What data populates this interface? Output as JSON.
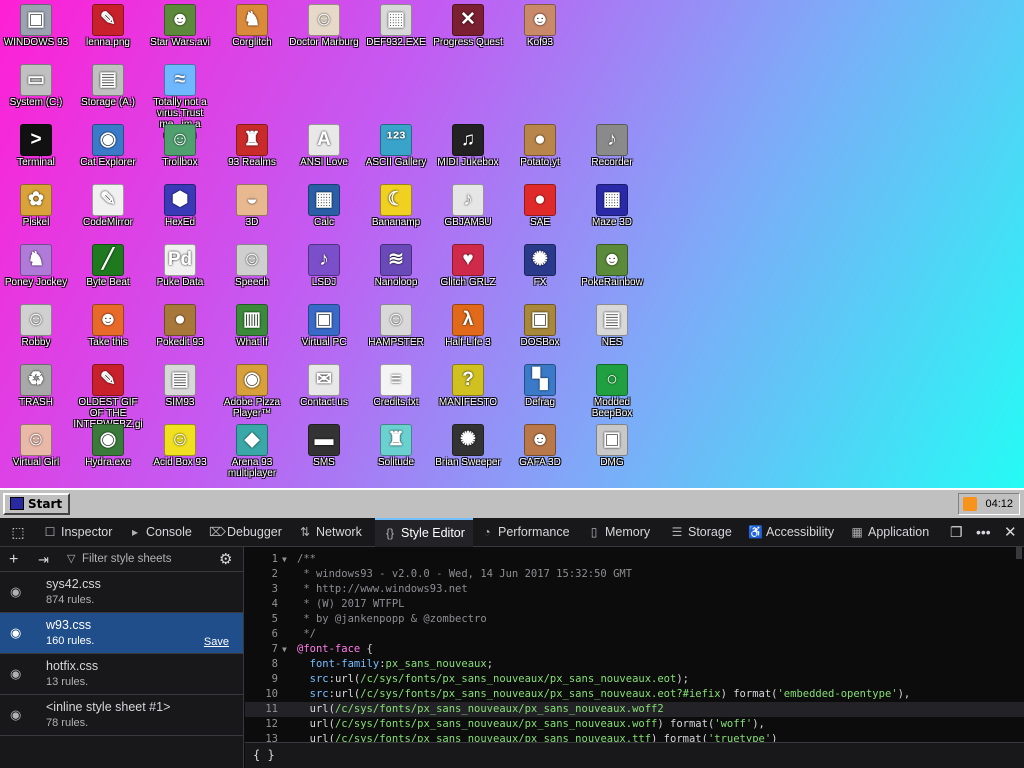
{
  "desktop": {
    "icons": [
      {
        "label": "WINDOWS 93",
        "glyph": "▣",
        "color": "#9ca3b0"
      },
      {
        "label": "lenna.png",
        "glyph": "✎",
        "color": "#c9212b"
      },
      {
        "label": "Star Wars.avi",
        "glyph": "☻",
        "color": "#5d8a3a"
      },
      {
        "label": "Corglitch",
        "glyph": "♞",
        "color": "#d98a3a"
      },
      {
        "label": "Doctor Marburg",
        "glyph": "☺",
        "color": "#e6d9c9"
      },
      {
        "label": "DEF932.EXE",
        "glyph": "▦",
        "color": "#d8d8d8"
      },
      {
        "label": "Progress Quest",
        "glyph": "✕",
        "color": "#7a2030"
      },
      {
        "label": "Kof93",
        "glyph": "☻",
        "color": "#c98a6a"
      },
      {
        "label": "System (C:)",
        "glyph": "▭",
        "color": "#c0c0c0"
      },
      {
        "label": "Storage (A:)",
        "glyph": "▤",
        "color": "#c0c0c0"
      },
      {
        "label": "Totally not a virus.Trust me...im a dolphin",
        "glyph": "≈",
        "color": "#6fb7ff"
      },
      {
        "label": "Terminal",
        "glyph": ">",
        "color": "#111111"
      },
      {
        "label": "Cat Explorer",
        "glyph": "◉",
        "color": "#3a7ac9"
      },
      {
        "label": "Trollbox",
        "glyph": "☺",
        "color": "#4f9f6f"
      },
      {
        "label": "93 Realms",
        "glyph": "♜",
        "color": "#c92b2b"
      },
      {
        "label": "ANSI Love",
        "glyph": "A",
        "color": "#e8e8e8"
      },
      {
        "label": "ASCII Gallery",
        "glyph": "¹²³",
        "color": "#3aa3c9"
      },
      {
        "label": "MIDI Jukebox",
        "glyph": "♫",
        "color": "#222222"
      },
      {
        "label": "Potato.yt",
        "glyph": "●",
        "color": "#b8864a"
      },
      {
        "label": "Recorder",
        "glyph": "♪",
        "color": "#8a8a8a"
      },
      {
        "label": "Piskel",
        "glyph": "✿",
        "color": "#d9a23a"
      },
      {
        "label": "CodeMirror",
        "glyph": "✎",
        "color": "#f0f0f0"
      },
      {
        "label": "HexEd",
        "glyph": "⬢",
        "color": "#3a3ab8"
      },
      {
        "label": "3D",
        "glyph": "◒",
        "color": "#e8b890"
      },
      {
        "label": "Calc",
        "glyph": "▦",
        "color": "#2a5fa8"
      },
      {
        "label": "Bananamp",
        "glyph": "☾",
        "color": "#f0d020"
      },
      {
        "label": "GBJAM3U",
        "glyph": "♪",
        "color": "#e6e6e6"
      },
      {
        "label": "SAE",
        "glyph": "●",
        "color": "#e02a2a"
      },
      {
        "label": "Maze 3D",
        "glyph": "▦",
        "color": "#2a2aa8"
      },
      {
        "label": "Poney Jockey",
        "glyph": "♞",
        "color": "#b07ad9"
      },
      {
        "label": "Byte Beat",
        "glyph": "╱",
        "color": "#1f7a1f"
      },
      {
        "label": "Puke Data",
        "glyph": "Pd",
        "color": "#f0f0f0"
      },
      {
        "label": "Speech",
        "glyph": "☺",
        "color": "#cfcfcf"
      },
      {
        "label": "LSDJ",
        "glyph": "♪",
        "color": "#7a4fc9"
      },
      {
        "label": "Nanoloop",
        "glyph": "≋",
        "color": "#6a4ab8"
      },
      {
        "label": "Glitch GRLZ",
        "glyph": "♥",
        "color": "#d02a4a"
      },
      {
        "label": "FX",
        "glyph": "✺",
        "color": "#2a3a8a"
      },
      {
        "label": "PokeRainbow",
        "glyph": "☻",
        "color": "#5a8a3a"
      },
      {
        "label": "Robby",
        "glyph": "☺",
        "color": "#d0d0d0"
      },
      {
        "label": "Take this",
        "glyph": "☻",
        "color": "#e86a2a"
      },
      {
        "label": "Pokedit 93",
        "glyph": "●",
        "color": "#a8783a"
      },
      {
        "label": "What If",
        "glyph": "▥",
        "color": "#3a8a3a"
      },
      {
        "label": "Virtual PC",
        "glyph": "▣",
        "color": "#3a6ac9"
      },
      {
        "label": "HAMPSTER",
        "glyph": "☺",
        "color": "#d8d8d8"
      },
      {
        "label": "Half-Life 3",
        "glyph": "λ",
        "color": "#e06a1a"
      },
      {
        "label": "DOSBox",
        "glyph": "▣",
        "color": "#a8883a"
      },
      {
        "label": "NES",
        "glyph": "▤",
        "color": "#d8d8d8"
      },
      {
        "label": "TRASH",
        "glyph": "♻",
        "color": "#a8a8a8"
      },
      {
        "label": "OLDEST GIF OF THE INTERWEBZ.gif",
        "glyph": "✎",
        "color": "#c9212b"
      },
      {
        "label": "SIM93",
        "glyph": "▤",
        "color": "#d8d8d8"
      },
      {
        "label": "Adobe Pizza Player™",
        "glyph": "◉",
        "color": "#d8a03a"
      },
      {
        "label": "Contact us",
        "glyph": "✉",
        "color": "#e8e8e8"
      },
      {
        "label": "Credits.txt",
        "glyph": "≡",
        "color": "#f4f4f4"
      },
      {
        "label": "MANIFESTO",
        "glyph": "?",
        "color": "#d0c020"
      },
      {
        "label": "Defrag",
        "glyph": "▚",
        "color": "#3a7ac9"
      },
      {
        "label": "Modded BeepBox",
        "glyph": "○",
        "color": "#20a040"
      },
      {
        "label": "Virtual Girl",
        "glyph": "☺",
        "color": "#e8b8a8"
      },
      {
        "label": "Hydra.exe",
        "glyph": "◉",
        "color": "#3a7a3a"
      },
      {
        "label": "Acid Box 93",
        "glyph": "☺",
        "color": "#f0e020"
      },
      {
        "label": "Arena 93 multiplayer",
        "glyph": "◆",
        "color": "#3aa8a8"
      },
      {
        "label": "SMS",
        "glyph": "▬",
        "color": "#333333"
      },
      {
        "label": "Solitude",
        "glyph": "♜",
        "color": "#6ad0d0"
      },
      {
        "label": "Brian Sweeper",
        "glyph": "✺",
        "color": "#333333"
      },
      {
        "label": "GAFA 3D",
        "glyph": "☻",
        "color": "#b8784a"
      },
      {
        "label": "DMG",
        "glyph": "▣",
        "color": "#c8c8c8"
      }
    ]
  },
  "taskbar": {
    "start_label": "Start",
    "clock": "04:12"
  },
  "devtools": {
    "tabs": [
      {
        "label": "Inspector",
        "icon": "☐"
      },
      {
        "label": "Console",
        "icon": "▸"
      },
      {
        "label": "Debugger",
        "icon": "⌦"
      },
      {
        "label": "Network",
        "icon": "⇅"
      },
      {
        "label": "Style Editor",
        "icon": "{}"
      },
      {
        "label": "Performance",
        "icon": "◔"
      },
      {
        "label": "Memory",
        "icon": "▯"
      },
      {
        "label": "Storage",
        "icon": "☰"
      },
      {
        "label": "Accessibility",
        "icon": "♿"
      },
      {
        "label": "Application",
        "icon": "▦"
      }
    ],
    "filter_placeholder": "Filter style sheets",
    "sheets": [
      {
        "name": "sys42.css",
        "rules": "874 rules."
      },
      {
        "name": "w93.css",
        "rules": "160 rules.",
        "save": "Save"
      },
      {
        "name": "hotfix.css",
        "rules": "13 rules."
      },
      {
        "name": "<inline style sheet #1>",
        "rules": "78 rules."
      }
    ],
    "status_text": "{ }"
  }
}
